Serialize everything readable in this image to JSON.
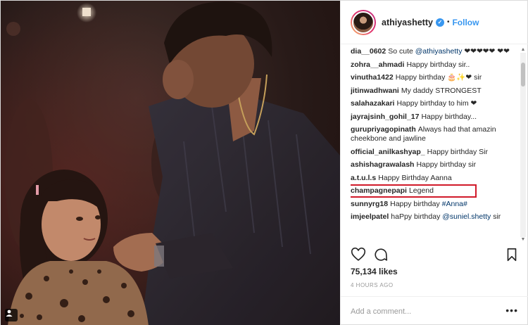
{
  "post": {
    "username": "athiyashetty",
    "follow_label": "Follow",
    "separator": "•",
    "likes": "75,134 likes",
    "time_ago": "4 HOURS AGO",
    "add_comment_placeholder": "Add a comment...",
    "more_options": "•••"
  },
  "comments": [
    {
      "user": "dia__0602",
      "text": "So cute ",
      "mention": "@athiyashetty",
      "suffix": " ❤❤❤❤❤ ❤❤"
    },
    {
      "user": "zohra__ahmadi",
      "text": "Happy birthday sir.."
    },
    {
      "user": "vinutha1422",
      "text": "Happy birthday 🎂✨❤ sir"
    },
    {
      "user": "jitinwadhwani",
      "text": "My daddy STRONGEST"
    },
    {
      "user": "salahazakari",
      "text": "Happy birthday to him ❤"
    },
    {
      "user": "jayrajsinh_gohil_17",
      "text": "Happy birthday..."
    },
    {
      "user": "gurupriyagopinath",
      "text": "Always had that amazin cheekbone and jawline"
    },
    {
      "user": "official_anilkashyap_",
      "text": "Happy birthday Sir"
    },
    {
      "user": "ashishagrawalash",
      "text": "Happy birthday sir"
    },
    {
      "user": "a.t.u.l.s",
      "text": "Happy Birthday Aanna"
    },
    {
      "user": "champagnepapi",
      "text": "Legend"
    },
    {
      "user": "sunnyrg18",
      "text": "Happy birthday ",
      "mention": "#Anna#"
    },
    {
      "user": "imjeelpatel",
      "text": "haPpy birthday ",
      "mention": "@suniel.shetty",
      "suffix": " sir"
    }
  ],
  "colors": {
    "link_blue": "#3897f0",
    "highlight_red": "#d11a2a",
    "text": "#262626",
    "muted": "#999999"
  },
  "icons": [
    "verified-badge-icon",
    "heart-icon",
    "comment-icon",
    "bookmark-icon",
    "tag-user-icon",
    "scroll-up-arrow-icon",
    "scroll-down-arrow-icon"
  ]
}
